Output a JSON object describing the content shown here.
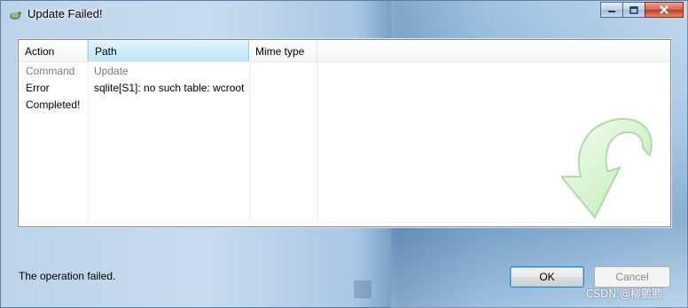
{
  "window": {
    "title": "Update Failed!",
    "app_icon": "tortoise-svn-icon",
    "controls": [
      "minimize-icon",
      "maximize-icon",
      "close-icon"
    ]
  },
  "list": {
    "columns": [
      "Action",
      "Path",
      "Mime type"
    ],
    "rows": [
      {
        "action": "Command",
        "path": "Update",
        "mime": ""
      },
      {
        "action": "Error",
        "path": "sqlite[S1]: no such table: wcroot",
        "mime": ""
      },
      {
        "action": "Completed!",
        "path": "",
        "mime": ""
      }
    ]
  },
  "status": "The operation failed.",
  "buttons": {
    "ok": "OK",
    "cancel": "Cancel"
  },
  "watermark": "CSDN @柳鹏鹏",
  "colors": {
    "header_active": "#bfe6f8",
    "command_text": "#7a7a7a",
    "update_arrow": "#c8f0c0"
  }
}
